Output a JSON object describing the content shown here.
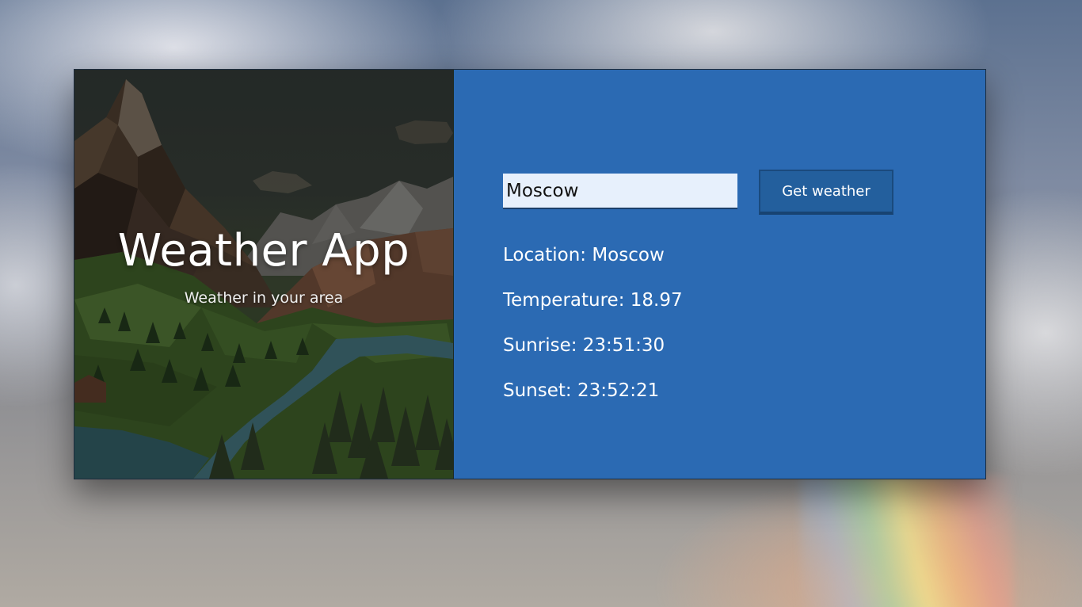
{
  "hero": {
    "title": "Weather App",
    "subtitle": "Weather in your area"
  },
  "search": {
    "value": "Moscow",
    "button_label": "Get weather"
  },
  "results": {
    "location": "Location: Moscow",
    "temperature": "Temperature: 18.97",
    "sunrise": "Sunrise: 23:51:30",
    "sunset": "Sunset: 23:52:21"
  },
  "colors": {
    "panel": "#2b6ab3",
    "button": "#235f9d",
    "input_bg": "#e7f0fc"
  }
}
